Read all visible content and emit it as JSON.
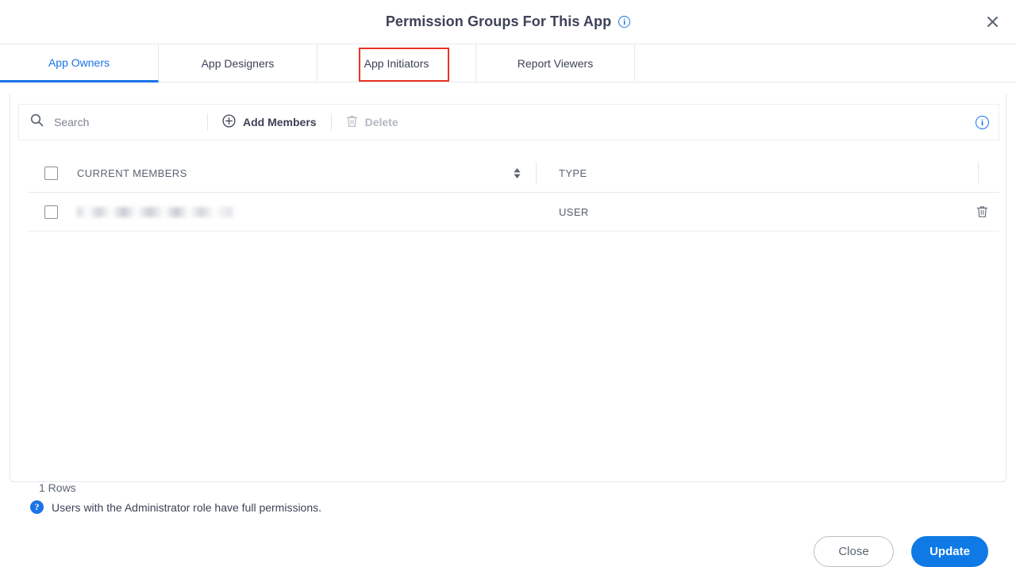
{
  "dialog": {
    "title": "Permission Groups For This App",
    "title_info_icon": "info-icon",
    "close_icon": "close-icon"
  },
  "tabs": [
    {
      "label": "App Owners",
      "active": true
    },
    {
      "label": "App Designers",
      "active": false
    },
    {
      "label": "App Initiators",
      "active": false,
      "highlighted": true
    },
    {
      "label": "Report Viewers",
      "active": false
    }
  ],
  "toolbar": {
    "search_placeholder": "Search",
    "search_value": "",
    "search_icon": "search-icon",
    "add_members_label": "Add Members",
    "add_members_icon": "plus-circle-icon",
    "delete_label": "Delete",
    "delete_icon": "trash-icon",
    "delete_disabled": true,
    "info_icon": "info-icon"
  },
  "table": {
    "columns": [
      {
        "key": "members",
        "header": "CURRENT MEMBERS",
        "sortable": true
      },
      {
        "key": "type",
        "header": "TYPE",
        "sortable": false
      }
    ],
    "rows": [
      {
        "member": "",
        "member_redacted": true,
        "type": "USER",
        "delete_icon": "trash-icon"
      }
    ]
  },
  "footer": {
    "rows_count": "1 Rows",
    "help_icon": "question-circle-icon",
    "admin_note": "Users with the Administrator role have full permissions."
  },
  "actions": {
    "close_label": "Close",
    "update_label": "Update"
  },
  "colors": {
    "accent": "#1a73e8",
    "primary_button": "#0f7ae5",
    "highlight_box": "#ea3323",
    "text": "#3c4257",
    "muted_text": "#7d838f",
    "border": "#e6e8ec"
  }
}
